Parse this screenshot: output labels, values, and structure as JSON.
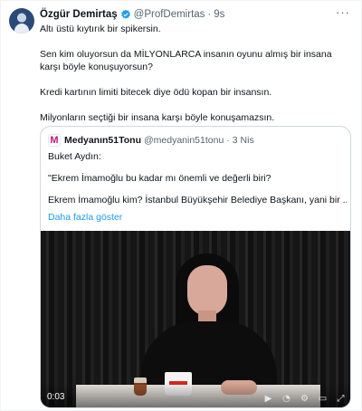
{
  "tweet": {
    "author_name": "Özgür Demirtaş",
    "handle": "@ProfDemirtas",
    "separator": "·",
    "time": "9s",
    "more_icon": "more-icon",
    "paragraphs": [
      "Altı üstü kıytırık bir spikersin.",
      "Sen kim oluyorsun da MİLYONLARCA insanın oyunu almış bir insana karşı böyle konuşuyorsun?",
      "Kredi kartının limiti bitecek diye ödü kopan bir insansın.",
      "Milyonların seçtiği bir insana karşı böyle konuşamazsın."
    ]
  },
  "quote": {
    "logo_letter": "M",
    "author_name": "Medyanın51Tonu",
    "handle": "@medyanin51tonu",
    "separator": "·",
    "time": "3 Nis",
    "paragraphs": [
      "Buket Aydın:",
      "\"Ekrem İmamoğlu bu kadar mı önemli ve değerli biri?",
      "Ekrem İmamoğlu kim? İstanbul Büyükşehir Belediye Başkanı, yani bir ..."
    ],
    "show_more": "Daha fazla göster",
    "video": {
      "timecode": "0:03",
      "controls": [
        "play-icon",
        "volume-icon",
        "settings-icon",
        "pip-icon",
        "fullscreen-icon"
      ]
    }
  },
  "colors": {
    "link": "#1d9bf0",
    "verified": "#1d9bf0",
    "muted": "#536471",
    "brand_logo": "#c2167a"
  }
}
